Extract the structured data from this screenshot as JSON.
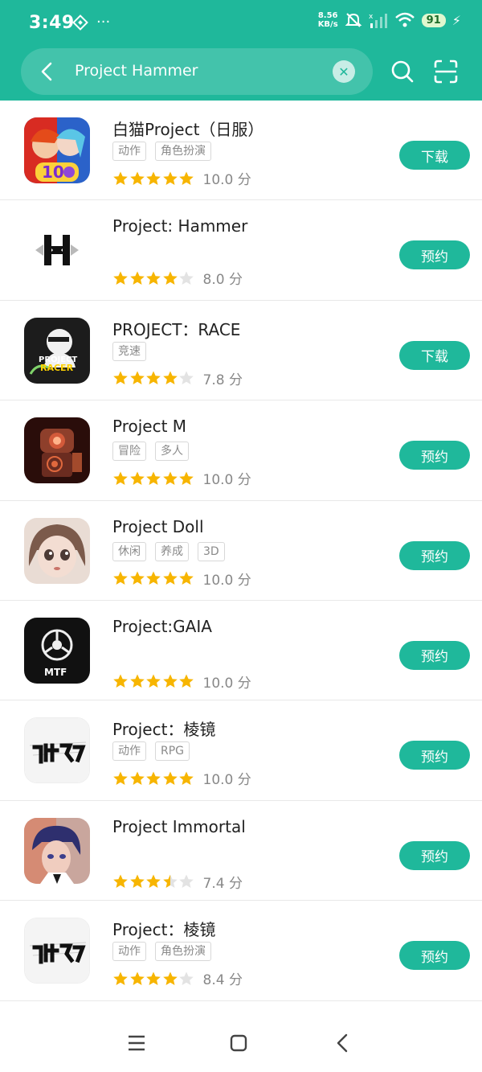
{
  "status": {
    "time": "3:49",
    "net_speed_value": "8.56",
    "net_speed_unit": "KB/s",
    "battery": "91"
  },
  "search": {
    "query": "Project Hammer"
  },
  "apps": [
    {
      "name": "白猫Project（日服）",
      "tags": [
        "动作",
        "角色扮演"
      ],
      "stars": 5,
      "score": "10.0 分",
      "action": "下载"
    },
    {
      "name": "Project: Hammer",
      "tags": [],
      "stars": 4,
      "score": "8.0 分",
      "action": "预约"
    },
    {
      "name": "PROJECT：RACE",
      "tags": [
        "竞速"
      ],
      "stars": 4,
      "score": "7.8 分",
      "action": "下载"
    },
    {
      "name": "Project M",
      "tags": [
        "冒险",
        "多人"
      ],
      "stars": 5,
      "score": "10.0 分",
      "action": "预约"
    },
    {
      "name": "Project Doll",
      "tags": [
        "休闲",
        "养成",
        "3D"
      ],
      "stars": 5,
      "score": "10.0 分",
      "action": "预约"
    },
    {
      "name": "Project:GAIA",
      "tags": [],
      "stars": 5,
      "score": "10.0 分",
      "action": "预约"
    },
    {
      "name": "Project：棱镜",
      "tags": [
        "动作",
        "RPG"
      ],
      "stars": 5,
      "score": "10.0 分",
      "action": "预约"
    },
    {
      "name": "Project Immortal",
      "tags": [],
      "stars": 3.5,
      "score": "7.4 分",
      "action": "预约"
    },
    {
      "name": "Project：棱镜",
      "tags": [
        "动作",
        "角色扮演"
      ],
      "stars": 4,
      "score": "8.4 分",
      "action": "预约"
    }
  ],
  "icon_texts": {
    "racer_top": "PROJECT",
    "racer_bottom": "RACER",
    "gaia": "MTF",
    "shiro": "10"
  },
  "colors": {
    "accent": "#1fb89b",
    "star": "#f7b500",
    "star_empty": "#e3e3e3"
  }
}
